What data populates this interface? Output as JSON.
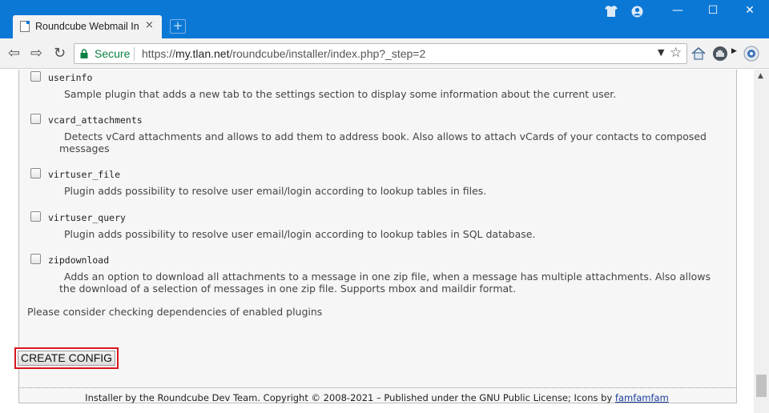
{
  "browser": {
    "tab_title": "Roundcube Webmail Inst",
    "tab_close": "×",
    "new_tab": "+",
    "window_controls": {
      "minimize": "—",
      "maximize": "☐",
      "close": "✕"
    },
    "nav": {
      "back": "⇦",
      "forward": "⇨",
      "reload": "↻"
    },
    "secure_label": "Secure",
    "url_scheme": "https://",
    "url_host": "my.tlan.net",
    "url_path": "/roundcube/installer/index.php?_step=2"
  },
  "plugins": [
    {
      "name": "userinfo",
      "description": "Sample plugin that adds a new tab to the settings section to display some information about the current user.",
      "checked": false
    },
    {
      "name": "vcard_attachments",
      "description": "Detects vCard attachments and allows to add them to address book. Also allows to attach vCards of your contacts to composed messages",
      "checked": false
    },
    {
      "name": "virtuser_file",
      "description": "Plugin adds possibility to resolve user email/login according to lookup tables in files.",
      "checked": false
    },
    {
      "name": "virtuser_query",
      "description": "Plugin adds possibility to resolve user email/login according to lookup tables in SQL database.",
      "checked": false
    },
    {
      "name": "zipdownload",
      "description": "Adds an option to download all attachments to a message in one zip file, when a message has multiple attachments. Also allows the download of a selection of messages in one zip file. Supports mbox and maildir format.",
      "checked": false
    }
  ],
  "note": "Please consider checking dependencies of enabled plugins",
  "create_button": "CREATE CONFIG",
  "footer": {
    "text": "Installer by the Roundcube Dev Team. Copyright © 2008-2021 – Published under the GNU Public License;  Icons by ",
    "link": "famfamfam"
  },
  "colors": {
    "titlebar": "#0b78d6",
    "secure": "#0b8043",
    "highlight_border": "#d9141d"
  }
}
